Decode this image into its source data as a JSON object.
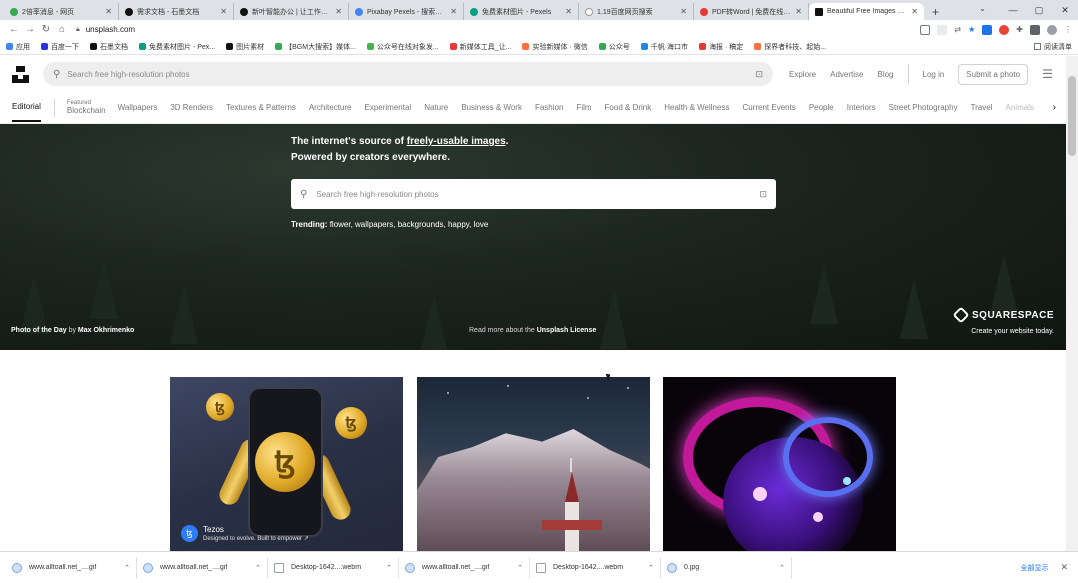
{
  "browser": {
    "tabs": [
      {
        "label": "2倍率消息 - 网页",
        "color": "#34a853"
      },
      {
        "label": "需求文档 - 石墨文档",
        "color": "#111111"
      },
      {
        "label": "新叶智能办公 | 让工作技巧",
        "color": "#111111"
      },
      {
        "label": "Pixabay Pexels - 搜索结果",
        "color": "#4285f4"
      },
      {
        "label": "免费素材图片 - Pexels",
        "color": "#05a081"
      },
      {
        "label": "1.19百度网页搜索",
        "color": "#ffffff"
      },
      {
        "label": "PDF转Word | 免费在线PDF",
        "color": "#e53935"
      },
      {
        "label": "Beautiful Free Images & Pi",
        "color": "#111111"
      }
    ],
    "new_tab": "+",
    "url": "unsplash.com",
    "bookmarks": [
      {
        "label": "应用",
        "color": "#4285f4"
      },
      {
        "label": "百度一下",
        "color": "#2932e1"
      },
      {
        "label": "石墨文档",
        "color": "#111111"
      },
      {
        "label": "免费素材图片 - Pex...",
        "color": "#05a081"
      },
      {
        "label": "图片素材",
        "color": "#111111"
      },
      {
        "label": "【BGM大搜索】媒体...",
        "color": "#34a853"
      },
      {
        "label": "公众号在线对象发...",
        "color": "#4caf50"
      },
      {
        "label": "新媒体工具_让...",
        "color": "#e53935"
      },
      {
        "label": "实验新媒体 · 微信",
        "color": "#ff7043"
      },
      {
        "label": "公众号",
        "color": "#34a853"
      },
      {
        "label": "千帆·海口市",
        "color": "#1e88e5"
      },
      {
        "label": "海报 · 稿定",
        "color": "#e53935"
      },
      {
        "label": "探界者科技、起始...",
        "color": "#ff7043"
      }
    ],
    "reading_list": "阅读清单"
  },
  "site": {
    "search_placeholder": "Search free high-resolution photos",
    "nav": [
      "Explore",
      "Advertise",
      "Blog"
    ],
    "login": "Log in",
    "submit": "Submit a photo",
    "editorial": "Editorial",
    "featured_label": "Featured",
    "topics": [
      "Blockchain",
      "Wallpapers",
      "3D Renders",
      "Textures & Patterns",
      "Architecture",
      "Experimental",
      "Nature",
      "Business & Work",
      "Fashion",
      "Film",
      "Food & Drink",
      "Health & Wellness",
      "Current Events",
      "People",
      "Interiors",
      "Street Photography",
      "Travel",
      "Animals"
    ],
    "hero": {
      "line1_pre": "The internet's source of ",
      "line1_link": "freely-usable images",
      "line1_post": ".",
      "line2": "Powered by creators everywhere.",
      "search_placeholder": "Search free high-resolution photos",
      "trending_label": "Trending:",
      "trending_items": "flower, wallpapers, backgrounds, happy, love",
      "photo_of_day_pre": "Photo of the Day",
      "photo_of_day_by": " by ",
      "photo_of_day_author": "Max Okhrimenko",
      "license_pre": "Read more about the ",
      "license_link": "Unsplash License",
      "sponsor_name": "SQUARESPACE",
      "sponsor_tagline": "Create your website today."
    },
    "photos": {
      "sponsor_name": "Tezos",
      "sponsor_tagline": "Designed to evolve. Built to empower ↗"
    }
  },
  "downloads": {
    "items": [
      "www.alltoall.net_....gif",
      "www.alltoall.net_....gif",
      "Desktop-1642....webm",
      "www.alltoall.net_....gif",
      "Desktop-1642....webm",
      "0.jpg"
    ],
    "show_all": "全部显示"
  }
}
